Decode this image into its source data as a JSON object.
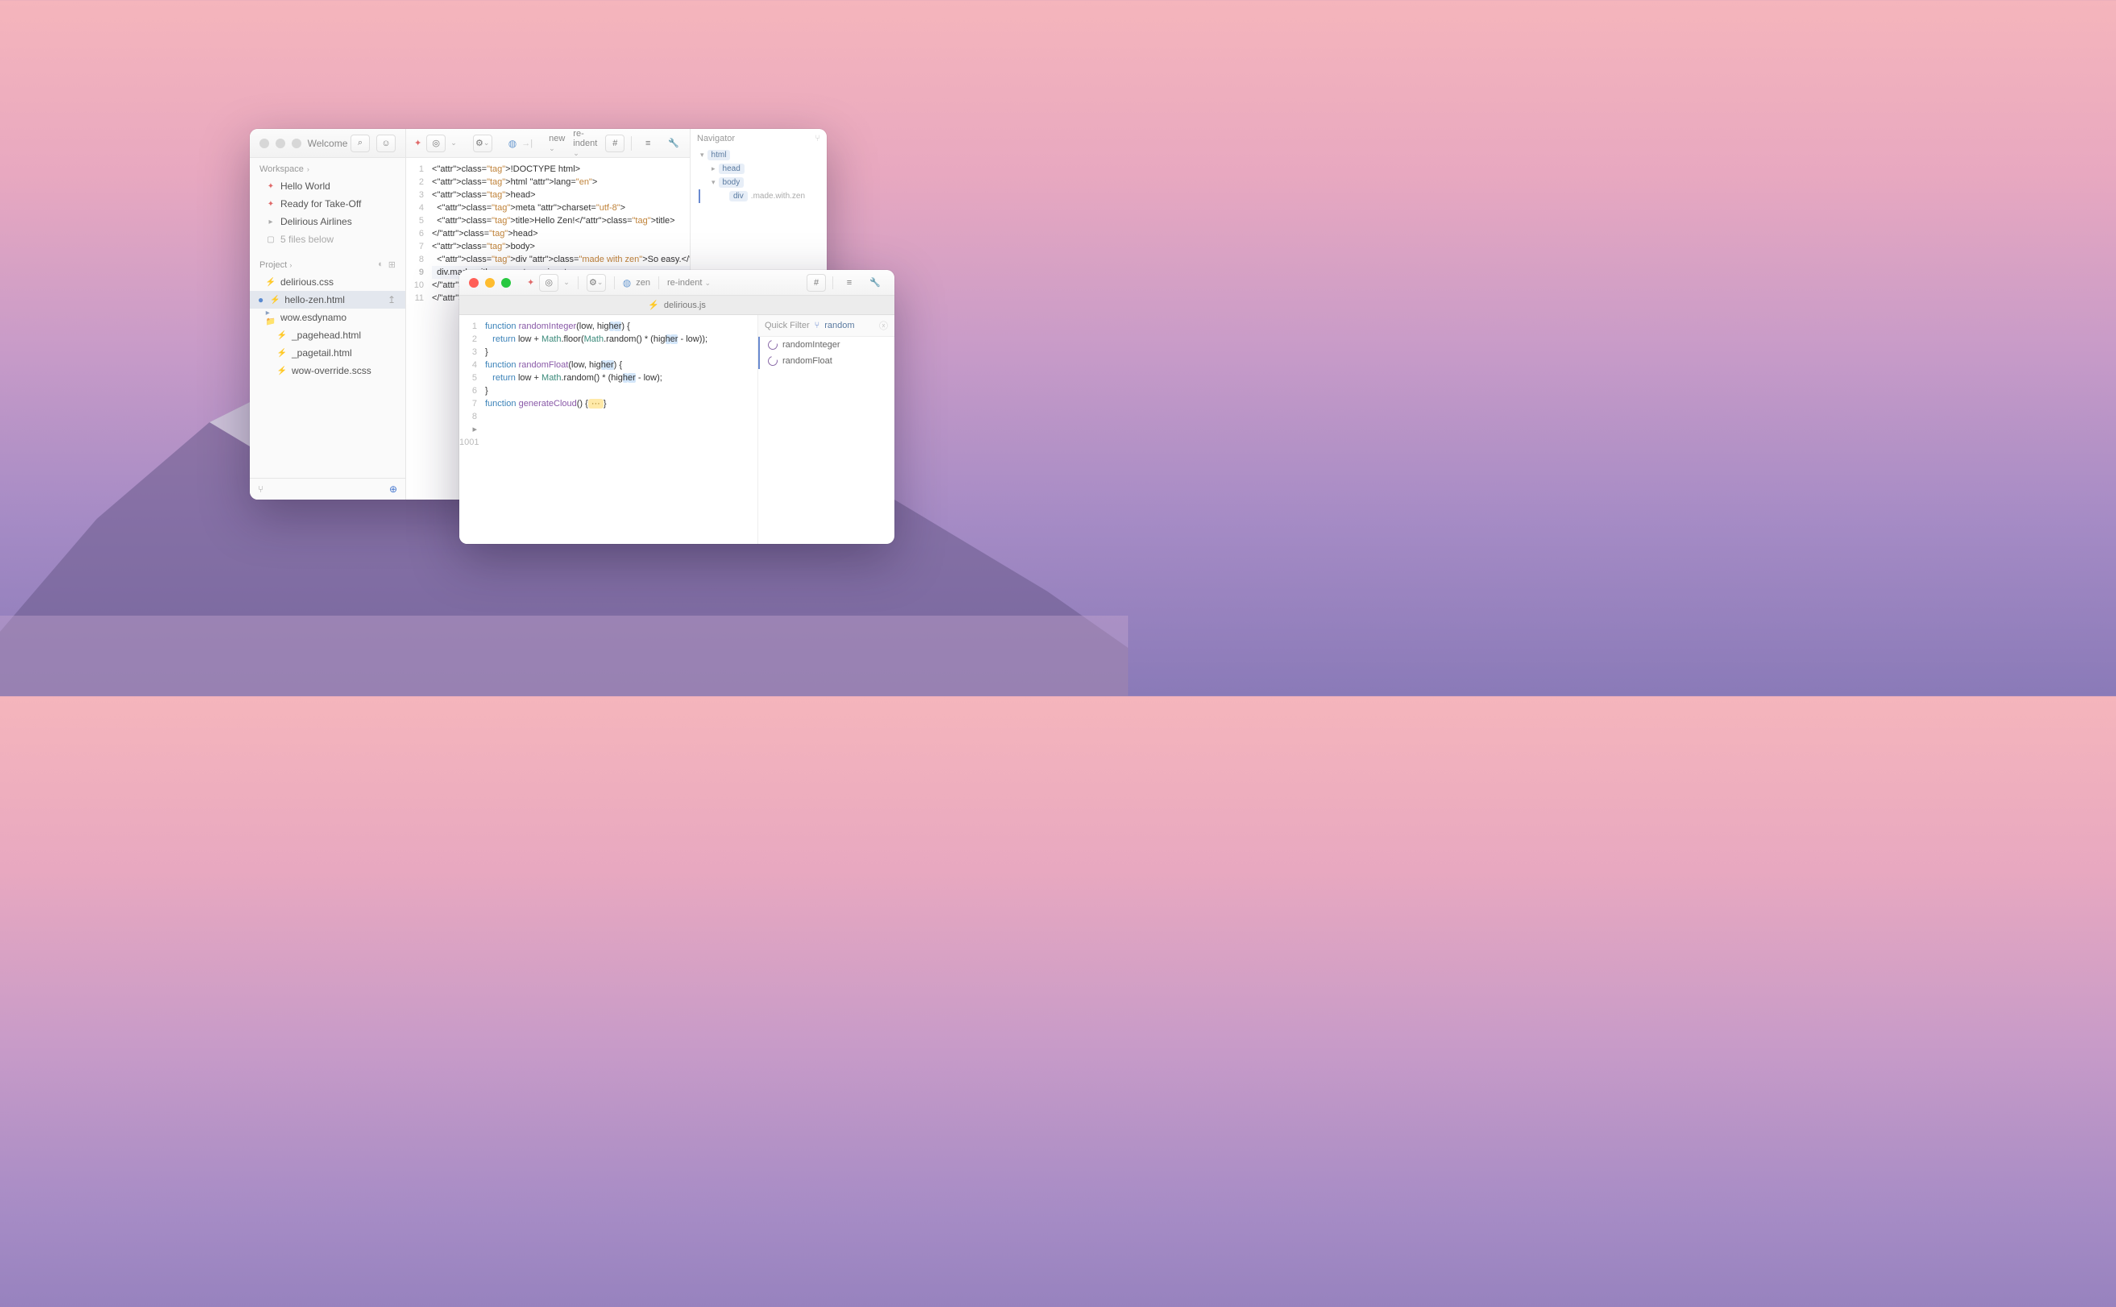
{
  "back": {
    "title": "Welcome",
    "workspace_label": "Workspace",
    "workspace_items": [
      "Hello World",
      "Ready for Take-Off",
      "Delirious Airlines"
    ],
    "files_below": "5 files below",
    "project_label": "Project",
    "files": [
      {
        "name": "delirious.css",
        "icon": "css"
      },
      {
        "name": "hello-zen.html",
        "icon": "html",
        "selected": true,
        "dirty": true
      },
      {
        "name": "wow.esdynamo",
        "icon": "folder"
      },
      {
        "name": "_pagehead.html",
        "icon": "html",
        "indent": true
      },
      {
        "name": "_pagetail.html",
        "icon": "html",
        "indent": true
      },
      {
        "name": "wow-override.scss",
        "icon": "css",
        "indent": true
      }
    ],
    "toolbar": {
      "new": "new",
      "reindent": "re-indent"
    },
    "code_lines": [
      "<!DOCTYPE html>",
      "<html lang=\"en\">",
      "<head>",
      "  <meta charset=\"utf-8\">",
      "  <title>Hello Zen!</title>",
      "</head>",
      "<body>",
      "  <div class=\"made with zen\">So easy.</div>",
      "  div.made.with.zen customsnippet",
      "</body>",
      "</html>"
    ],
    "navigator": {
      "title": "Navigator",
      "items": [
        {
          "tag": "html",
          "depth": 0,
          "open": true
        },
        {
          "tag": "head",
          "depth": 1,
          "closed": true
        },
        {
          "tag": "body",
          "depth": 1,
          "open": true
        },
        {
          "tag": "div",
          "depth": 2,
          "suffix": ".made.with.zen"
        }
      ]
    }
  },
  "front": {
    "toolbar": {
      "zen": "zen",
      "reindent": "re-indent"
    },
    "tab": "delirious.js",
    "quick_filter_label": "Quick Filter",
    "quick_filter_value": "random",
    "symbols": [
      "randomInteger",
      "randomFloat"
    ],
    "gutter": [
      "1",
      "2",
      "3",
      "4",
      "5",
      "6",
      "7",
      "8",
      "",
      "1001"
    ],
    "last_line_no": "1001"
  }
}
